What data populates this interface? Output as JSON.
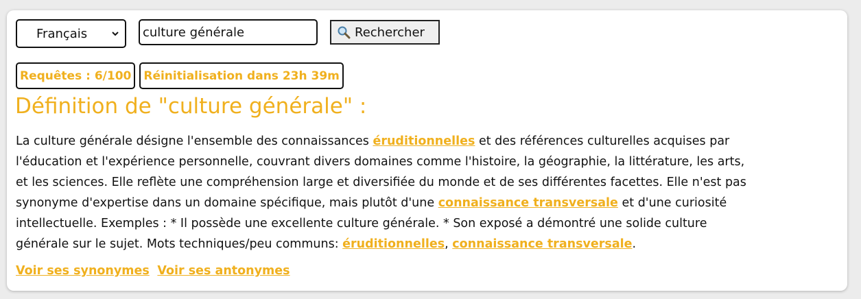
{
  "search": {
    "language": "Français",
    "query": "culture générale",
    "button_label": "Rechercher"
  },
  "quota": {
    "requests": "Requêtes : 6/100",
    "reset": "Réinitialisation dans 23h 39m"
  },
  "definition": {
    "title": "Définition de \"culture générale\" :",
    "line1_a": "La culture générale désigne l'ensemble des connaissances ",
    "line1_link": "éruditionnelles",
    "line1_b": " et des références culturelles acquises par",
    "line2": "l'éducation et l'expérience personnelle, couvrant divers domaines comme l'histoire, la géographie, la littérature, les arts,",
    "line3": "et les sciences. Elle reflète une compréhension large et diversifiée du monde et de ses différentes facettes. Elle n'est pas",
    "line4_a": "synonyme d'expertise dans un domaine spécifique, mais plutôt d'une ",
    "line4_link": "connaissance transversale",
    "line4_b": " et d'une curiosité",
    "line5": "intellectuelle. Exemples : * Il possède une excellente culture générale. * Son exposé a démontré une solide culture",
    "line6_a": "générale sur le sujet. Mots techniques/peu communs: ",
    "line6_link1": "éruditionnelles",
    "line6_sep": ", ",
    "line6_link2": "connaissance transversale",
    "line6_end": "."
  },
  "links": {
    "synonyms": "Voir ses synonymes",
    "antonyms": "Voir ses antonymes"
  },
  "colors": {
    "accent": "#f0b01e",
    "text": "#111111",
    "background": "#ececec",
    "card": "#ffffff"
  },
  "icons": {
    "search_button": "magnifier-icon",
    "select": "chevron-down-icon"
  }
}
